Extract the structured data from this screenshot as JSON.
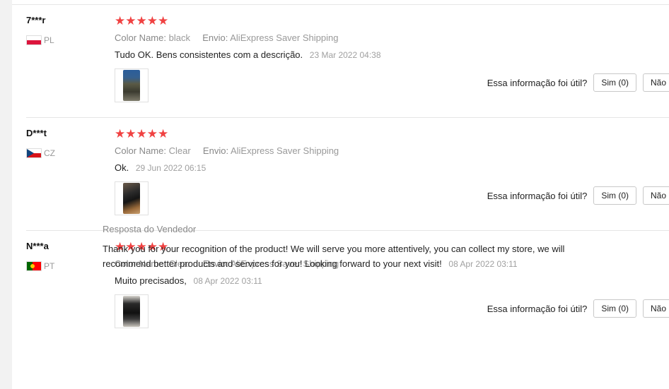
{
  "useful_question": "Essa informação foi útil?",
  "reviews": [
    {
      "user": "7***r",
      "country": "PL",
      "stars": "★★★★★",
      "color_label": "Color Name:",
      "color_value": "black",
      "shipping_label": "Envio:",
      "shipping_value": "AliExpress Saver Shipping",
      "text": "Tudo OK. Bens consistentes com a descrição.",
      "date": "23 Mar 2022 04:38",
      "yes_label": "Sim (0)",
      "no_label": "Não"
    },
    {
      "user": "D***t",
      "country": "CZ",
      "stars": "★★★★★",
      "color_label": "Color Name:",
      "color_value": "Clear",
      "shipping_label": "Envio:",
      "shipping_value": "AliExpress Saver Shipping",
      "text": "Ok.",
      "date": "29 Jun 2022 06:15",
      "yes_label": "Sim (0)",
      "no_label": "Não"
    },
    {
      "user": "N***a",
      "country": "PT",
      "stars": "★★★★★",
      "color_label": "Color Name:",
      "color_value": "Clear",
      "shipping_label": "Envio:",
      "shipping_value": "AliExpress Saver Shipping",
      "text": "Muito precisados,",
      "date": "08 Apr 2022 03:11",
      "yes_label": "Sim (0)",
      "no_label": "Não",
      "seller_reply": {
        "title": "Resposta do Vendedor",
        "text": "Thank you for your recognition of the product! We will serve you more attentively, you can collect my store, we will recommend better products and services for you! Looking forward to your next visit!",
        "date": "08 Apr 2022 03:11"
      }
    }
  ]
}
